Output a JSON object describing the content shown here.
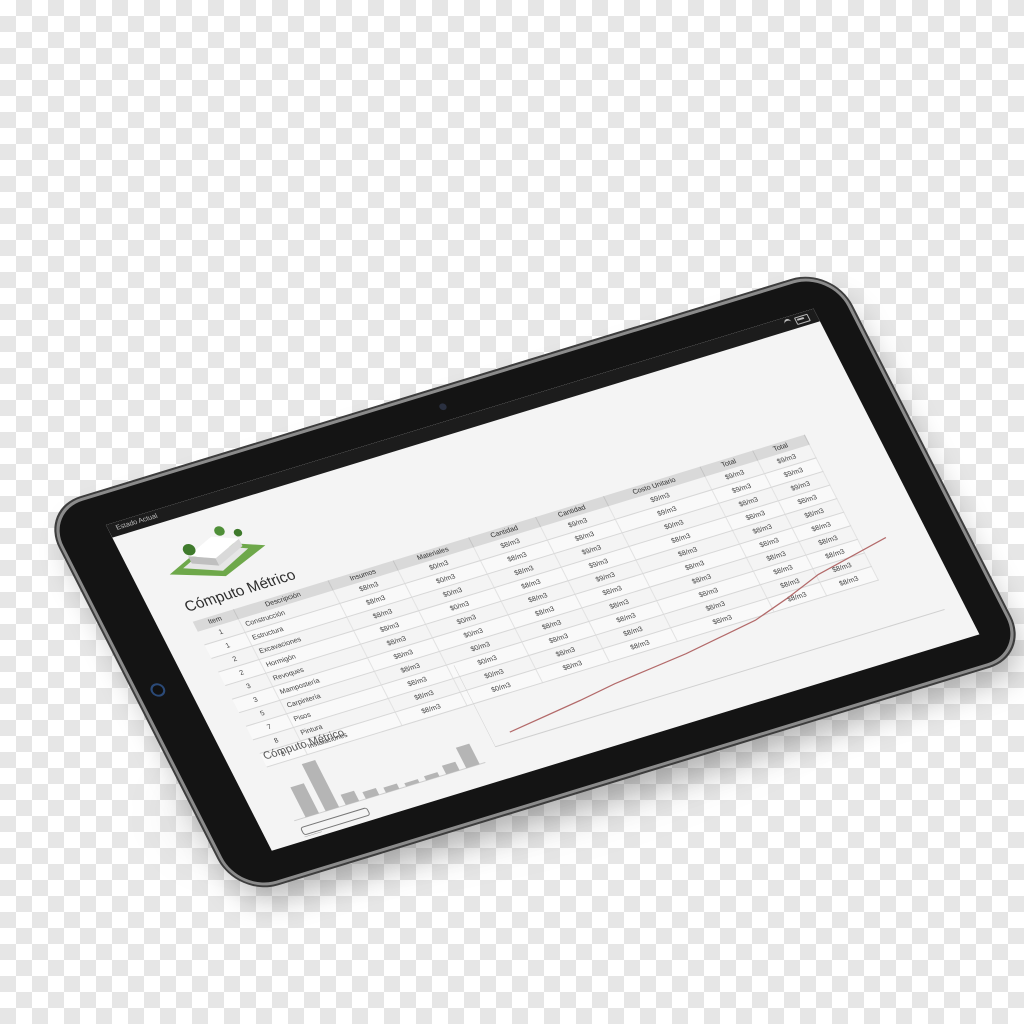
{
  "status": {
    "time": "Estado Actual"
  },
  "page": {
    "title": "Cómputo Métrico",
    "bottom_title": "Cómputo Métrico"
  },
  "table": {
    "headers": [
      "Item",
      "Descripción",
      "Insumos",
      "Materiales",
      "Cantidad",
      "Cantidad",
      "Costo Unitario",
      "Total",
      "Total"
    ],
    "rows": [
      [
        "1",
        "Construcción",
        "$8/m3",
        "$0/m3",
        "$8/m3",
        "$9/m3",
        "$9/m3",
        "$9/m3",
        "$9/m3"
      ],
      [
        "1",
        "Estructura",
        "$8/m3",
        "$0/m3",
        "$8/m3",
        "$8/m3",
        "$9/m3",
        "$9/m3",
        "$9/m3"
      ],
      [
        "2",
        "Excavaciones",
        "$8/m3",
        "$0/m3",
        "$8/m3",
        "$9/m3",
        "$0/m3",
        "$8/m3",
        "$9/m3"
      ],
      [
        "2",
        "Hormigón",
        "$8/m3",
        "$0/m3",
        "$8/m3",
        "$9/m3",
        "$8/m3",
        "$8/m3",
        "$8/m3"
      ],
      [
        "3",
        "Revoques",
        "$8/m3",
        "$0/m3",
        "$8/m3",
        "$9/m3",
        "$8/m3",
        "$8/m3",
        "$8/m3"
      ],
      [
        "3",
        "Mampostería",
        "$8/m3",
        "$0/m3",
        "$8/m3",
        "$8/m3",
        "$8/m3",
        "$8/m3",
        "$8/m3"
      ],
      [
        "5",
        "Carpintería",
        "$8/m3",
        "$0/m3",
        "$8/m3",
        "$8/m3",
        "$8/m3",
        "$8/m3",
        "$8/m3"
      ],
      [
        "7",
        "Pisos",
        "$8/m3",
        "$0/m3",
        "$8/m3",
        "$8/m3",
        "$8/m3",
        "$8/m3",
        "$8/m3"
      ],
      [
        "8",
        "Pintura",
        "$8/m3",
        "$0/m3",
        "$8/m3",
        "$8/m3",
        "$8/m3",
        "$8/m3",
        "$8/m3"
      ],
      [
        "8",
        "Instalaciones",
        "$8/m3",
        "$0/m3",
        "$8/m3",
        "$8/m3",
        "$8/m3",
        "$8/m3",
        "$8/m3"
      ]
    ]
  },
  "bar_chart": {
    "values": [
      35,
      55,
      12,
      8,
      6,
      4,
      5,
      10,
      24
    ]
  },
  "line_chart": {
    "values": [
      10,
      15,
      20,
      26,
      30,
      34,
      40,
      46,
      58,
      72,
      80,
      88
    ]
  },
  "footer": {
    "text": "———"
  },
  "colors": {
    "bezel": "#141414",
    "screen": "#f4f4f4",
    "header": "#d9d9d9",
    "line": "#b36a6a"
  }
}
